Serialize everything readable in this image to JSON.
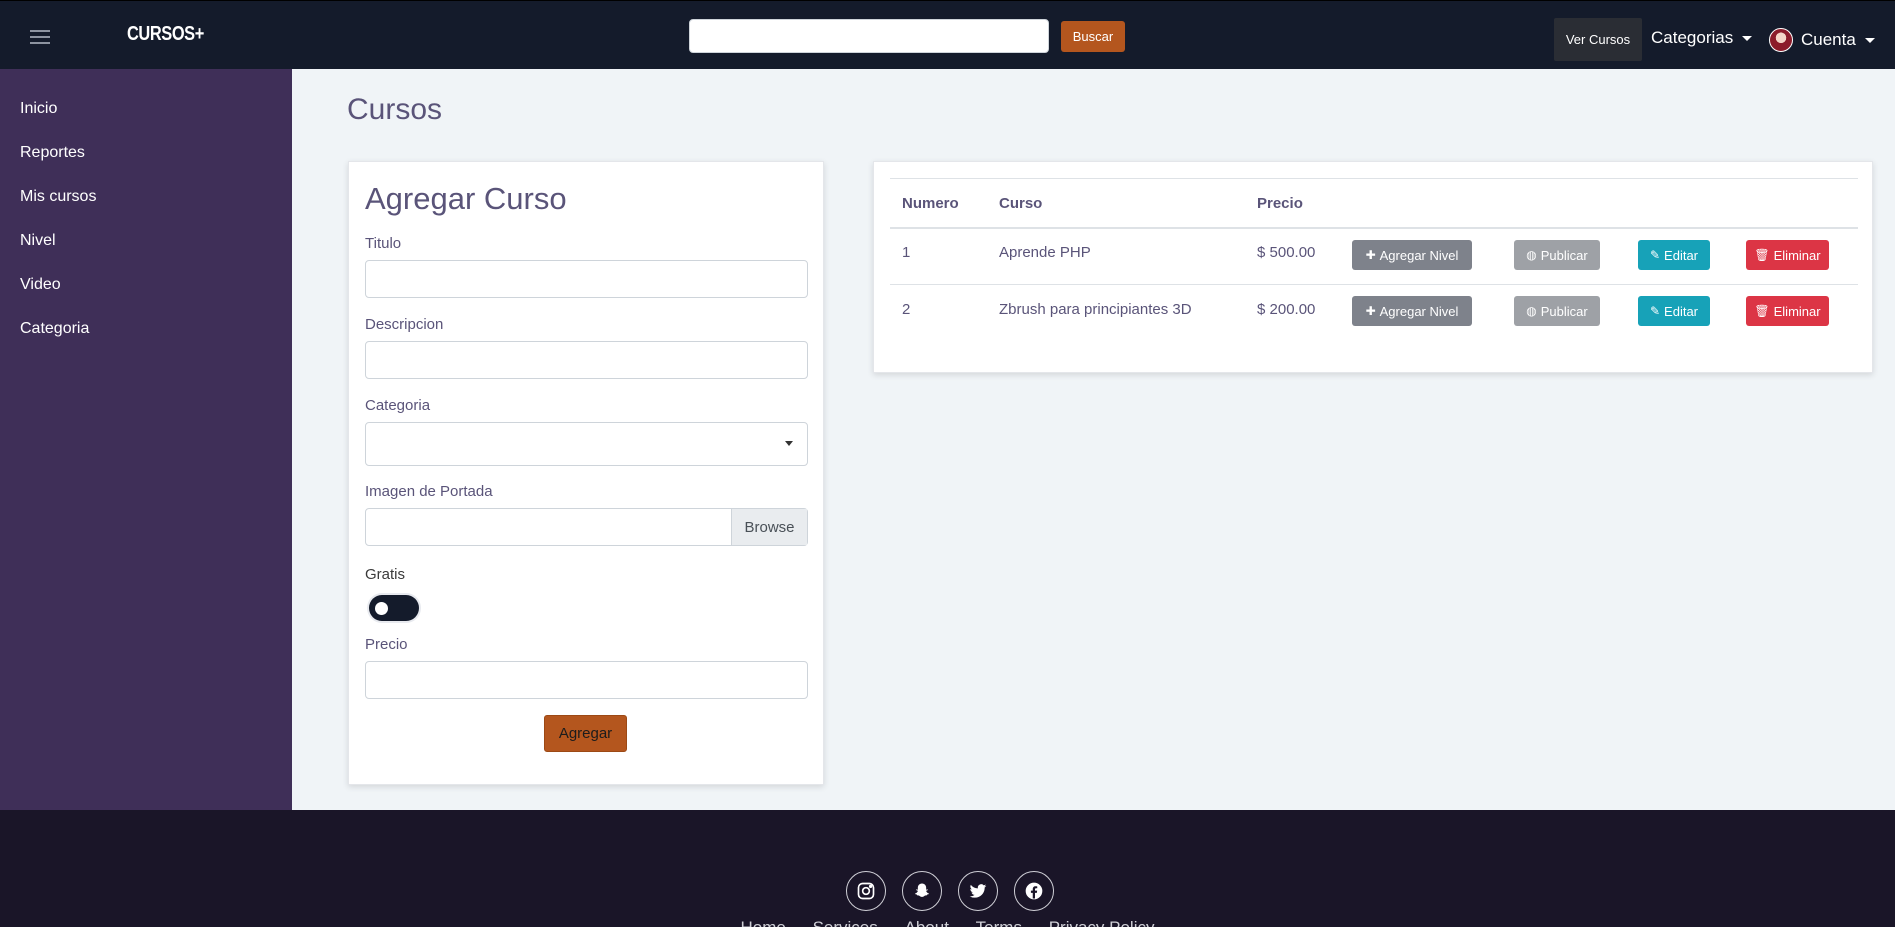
{
  "header": {
    "brand": "CURSOS+",
    "search_placeholder": "",
    "search_button": "Buscar",
    "ver_cursos": "Ver Cursos",
    "categorias": "Categorias",
    "cuenta": "Cuenta"
  },
  "sidebar": {
    "items": [
      {
        "label": "Inicio"
      },
      {
        "label": "Reportes"
      },
      {
        "label": "Mis cursos"
      },
      {
        "label": "Nivel"
      },
      {
        "label": "Video"
      },
      {
        "label": "Categoria"
      }
    ]
  },
  "page": {
    "title": "Cursos"
  },
  "form": {
    "heading": "Agregar Curso",
    "titulo_label": "Titulo",
    "titulo_value": "",
    "descripcion_label": "Descripcion",
    "descripcion_value": "",
    "categoria_label": "Categoria",
    "categoria_value": "",
    "imagen_label": "Imagen de Portada",
    "browse_label": "Browse",
    "gratis_label": "Gratis",
    "gratis_on": false,
    "precio_label": "Precio",
    "precio_value": "",
    "submit_label": "Agregar"
  },
  "table": {
    "headers": [
      "Numero",
      "Curso",
      "Precio"
    ],
    "rows": [
      {
        "numero": "1",
        "curso": "Aprende PHP",
        "precio": "$ 500.00"
      },
      {
        "numero": "2",
        "curso": "Zbrush para principiantes 3D",
        "precio": "$ 200.00"
      }
    ],
    "actions": {
      "nivel": "Agregar Nivel",
      "publicar": "Publicar",
      "editar": "Editar",
      "eliminar": "Eliminar"
    }
  },
  "footer": {
    "social": [
      "instagram-icon",
      "snapchat-icon",
      "twitter-icon",
      "facebook-icon"
    ],
    "links": [
      "Home",
      "Services",
      "About",
      "Terms",
      "Privacy Policy"
    ]
  },
  "colors": {
    "topbar": "#141b2b",
    "sidebar": "#3f2f58",
    "accent": "#b4561e",
    "footer": "#1a1528"
  }
}
